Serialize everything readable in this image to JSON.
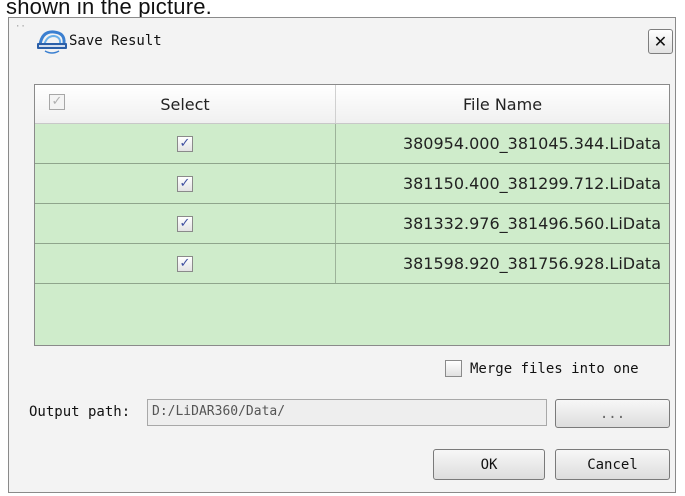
{
  "stray_text": "shown in the picture.",
  "window": {
    "title": "Save Result",
    "close_glyph": "✕",
    "corner_mark": "··",
    "logo_icon": "lidar360-logo-icon"
  },
  "table": {
    "header_checkbox_checked": true,
    "header_checkbox_glyph": "✓",
    "columns": [
      "Select",
      "File Name"
    ],
    "rows": [
      {
        "checked": true,
        "check_glyph": "✓",
        "file_name": "380954.000_381045.344.LiData"
      },
      {
        "checked": true,
        "check_glyph": "✓",
        "file_name": "381150.400_381299.712.LiData"
      },
      {
        "checked": true,
        "check_glyph": "✓",
        "file_name": "381332.976_381496.560.LiData"
      },
      {
        "checked": true,
        "check_glyph": "✓",
        "file_name": "381598.920_381756.928.LiData"
      }
    ]
  },
  "merge": {
    "label": "Merge files into one",
    "checked": false
  },
  "output": {
    "label": "Output path:",
    "value": "D:/LiDAR360/Data/",
    "browse_label": "..."
  },
  "buttons": {
    "ok": "OK",
    "cancel": "Cancel"
  },
  "colors": {
    "row_background": "#cfeccb",
    "dialog_background": "#f3f3f3",
    "checkmark": "#3f4fa0"
  }
}
